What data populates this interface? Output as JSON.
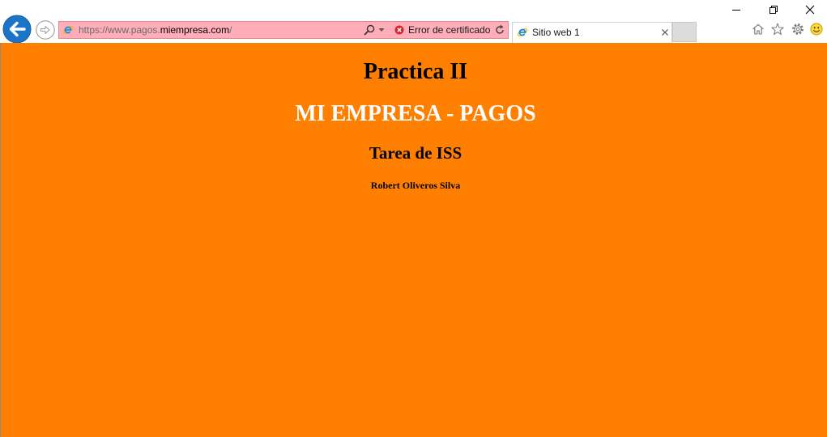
{
  "window": {
    "minimize_icon": "minimize-icon",
    "restore_icon": "restore-icon",
    "close_icon": "close-icon"
  },
  "navigation": {
    "back_icon": "back-arrow-icon",
    "forward_icon": "forward-arrow-icon"
  },
  "address_bar": {
    "url_scheme_host": "https://www.pagos.",
    "url_domain": "miempresa.com",
    "url_path": "/",
    "site_icon": "ie-icon",
    "search_icon": "search-icon",
    "dropdown_icon": "dropdown-icon",
    "certificate_icon": "certificate-error-icon",
    "certificate_status": "Error de certificado",
    "refresh_icon": "refresh-icon",
    "background_color": "#ffadb9"
  },
  "tabs": [
    {
      "title": "Sitio web 1",
      "icon": "ie-icon",
      "close_icon": "tab-close-icon",
      "active": true
    }
  ],
  "toolbar": {
    "icons": [
      "home-icon",
      "favorites-star-icon",
      "settings-gear-icon",
      "feedback-smiley-icon"
    ]
  },
  "page": {
    "background_color": "#ff8000",
    "title": "Practica II",
    "heading": "MI EMPRESA - PAGOS",
    "heading_color": "#ffffff",
    "subheading": "Tarea de ISS",
    "author": "Robert Oliveros Silva"
  }
}
